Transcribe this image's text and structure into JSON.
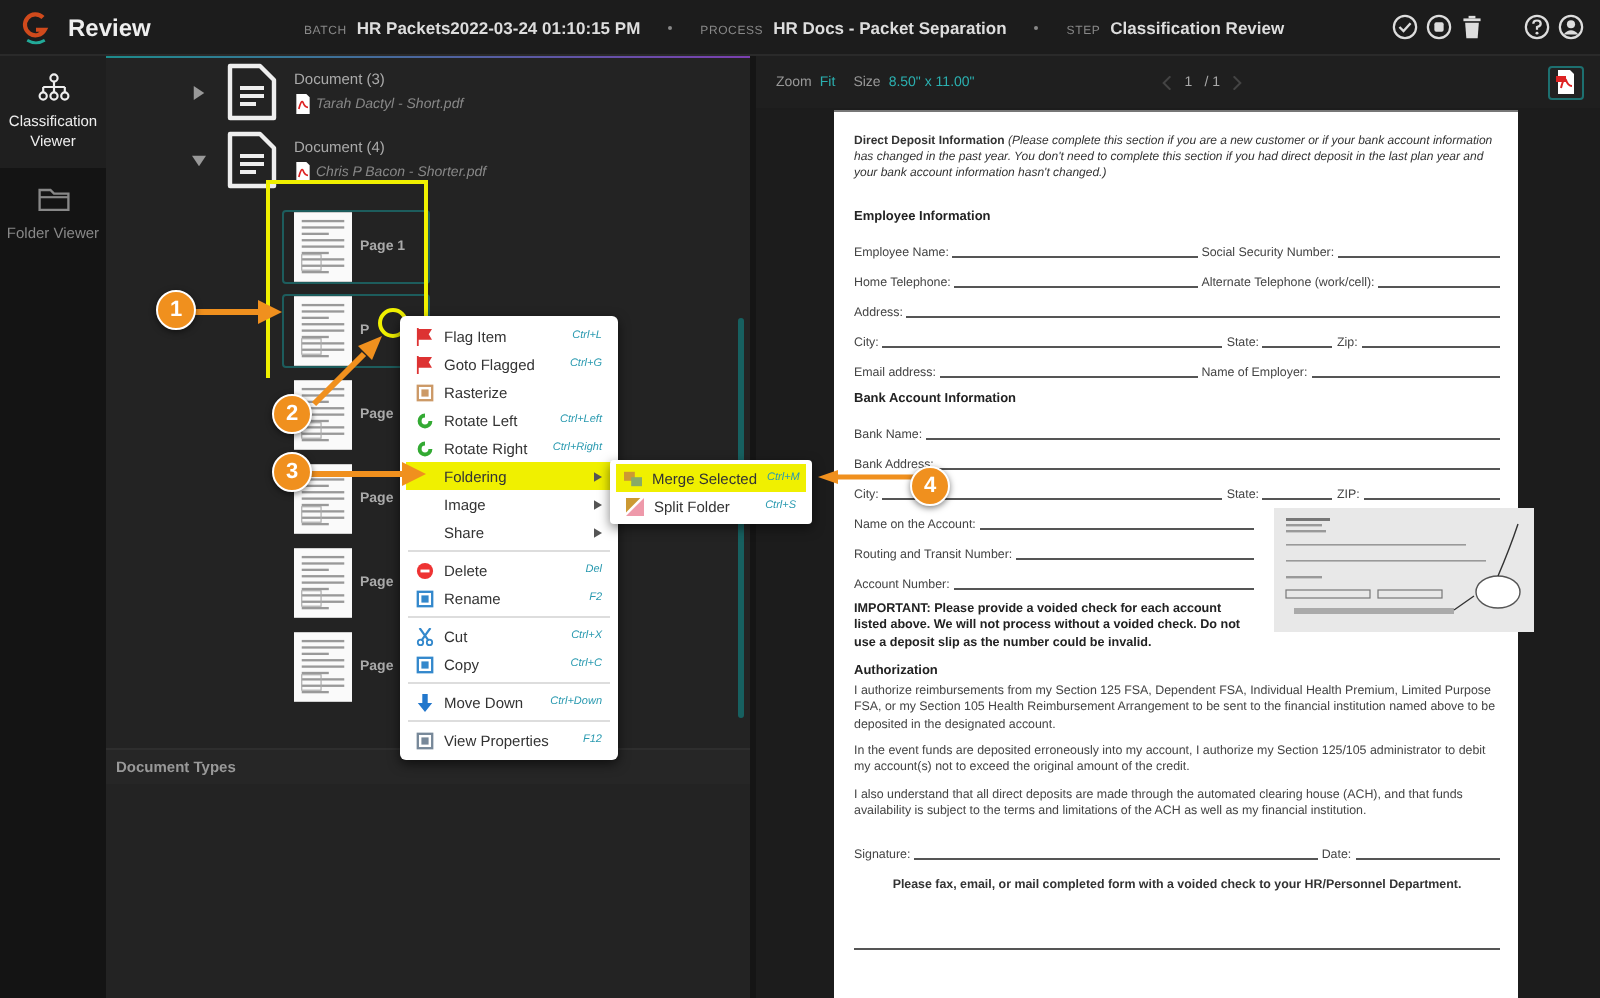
{
  "header": {
    "app_title": "Review",
    "batch_label": "BATCH",
    "batch": "HR Packets2022-03-24 01:10:15 PM",
    "process_label": "PROCESS",
    "process": "HR Docs - Packet Separation",
    "step_label": "STEP",
    "step": "Classification Review"
  },
  "nav": [
    {
      "label": "Classification Viewer",
      "selected": true
    },
    {
      "label": "Folder Viewer",
      "selected": false
    }
  ],
  "tree": {
    "documents": [
      {
        "title": "Document (3)",
        "file": "Tarah Dactyl - Short.pdf",
        "expanded": false
      },
      {
        "title": "Document (4)",
        "file": "Chris P Bacon - Shorter.pdf",
        "expanded": true,
        "pages": [
          {
            "label": "Page 1",
            "selected": true
          },
          {
            "label": "P",
            "selected": true
          },
          {
            "label": "Page",
            "selected": false
          },
          {
            "label": "Page",
            "selected": false
          },
          {
            "label": "Page",
            "selected": false
          },
          {
            "label": "Page",
            "selected": false
          }
        ]
      }
    ],
    "section": "Document Types"
  },
  "context_menu": {
    "groups": [
      [
        {
          "label": "Flag Item",
          "shortcut": "Ctrl+L",
          "highlighted": false,
          "submenu": false
        },
        {
          "label": "Goto Flagged",
          "shortcut": "Ctrl+G",
          "highlighted": false,
          "submenu": false
        },
        {
          "label": "Rasterize",
          "highlighted": false,
          "submenu": false
        },
        {
          "label": "Rotate Left",
          "shortcut": "Ctrl+Left",
          "highlighted": false,
          "submenu": false
        },
        {
          "label": "Rotate Right",
          "shortcut": "Ctrl+Right",
          "highlighted": false,
          "submenu": false
        },
        {
          "label": "Foldering",
          "highlighted": true,
          "submenu": true
        },
        {
          "label": "Image",
          "highlighted": false,
          "submenu": true
        },
        {
          "label": "Share",
          "highlighted": false,
          "submenu": true
        }
      ],
      [
        {
          "label": "Delete",
          "shortcut": "Del",
          "highlighted": false,
          "submenu": false
        },
        {
          "label": "Rename",
          "shortcut": "F2",
          "highlighted": false,
          "submenu": false
        }
      ],
      [
        {
          "label": "Cut",
          "shortcut": "Ctrl+X",
          "highlighted": false,
          "submenu": false
        },
        {
          "label": "Copy",
          "shortcut": "Ctrl+C",
          "highlighted": false,
          "submenu": false
        }
      ],
      [
        {
          "label": "Move Down",
          "shortcut": "Ctrl+Down",
          "highlighted": false,
          "submenu": false
        }
      ],
      [
        {
          "label": "View Properties",
          "shortcut": "F12",
          "highlighted": false,
          "submenu": false
        }
      ]
    ]
  },
  "submenu": [
    {
      "label": "Merge Selected",
      "shortcut": "Ctrl+M",
      "highlighted": true
    },
    {
      "label": "Split Folder",
      "shortcut": "Ctrl+S",
      "highlighted": false
    }
  ],
  "viewer": {
    "zoom_label": "Zoom",
    "zoom": "Fit",
    "size_label": "Size",
    "size": "8.50\" x 11.00\"",
    "page": "1",
    "total": "/ 1"
  },
  "document": {
    "intro": "**Direct Deposit Information** *(Please complete this section if you are a new customer or if your bank account information has changed in the past year. You don't need to complete this section if you had direct deposit in the last plan year and your bank account information hasn't changed.)*",
    "sections": [
      {
        "heading": "Employee Information",
        "rows": [
          [
            "Employee Name:",
            "Social Security Number:"
          ],
          [
            "Home Telephone:",
            "Alternate Telephone (work/cell):"
          ],
          [
            "Address:"
          ],
          [
            "City:",
            "State:",
            "Zip:"
          ],
          [
            "Email address:",
            "Name of Employer:"
          ]
        ]
      },
      {
        "heading": "Bank Account Information",
        "rows": [
          [
            "Bank Name:"
          ],
          [
            "Bank Address:"
          ],
          [
            "City:",
            "State:",
            "ZIP:"
          ]
        ]
      }
    ],
    "account_rows": [
      "Name on the Account:",
      "Routing and Transit Number:",
      "Account Number:"
    ],
    "important": "IMPORTANT: Please provide a voided check for each account listed above. We will not process without a voided check. Do not use a deposit slip as the number could be invalid.",
    "auth_heading": "Authorization",
    "paragraphs": [
      "I authorize reimbursements from my Section 125 FSA, Dependent FSA, Individual Health Premium, Limited Purpose FSA, or my Section 105 Health Reimbursement Arrangement to be sent to the financial institution named above to be deposited in the designated account.",
      "In the event funds are deposited erroneously into my account, I authorize my Section 125/105 administrator to debit my account(s) not to exceed the original amount of the credit.",
      "I also understand that all direct deposits are made through the automated clearing house (ACH), and that funds availability is subject to the terms and limitations of the ACH as well as my financial institution."
    ],
    "signature": "Signature:",
    "date": "Date:",
    "footer": "Please fax, email, or mail completed form with a voided check to your HR/Personnel Department."
  },
  "callouts": [
    "1",
    "2",
    "3",
    "4"
  ]
}
